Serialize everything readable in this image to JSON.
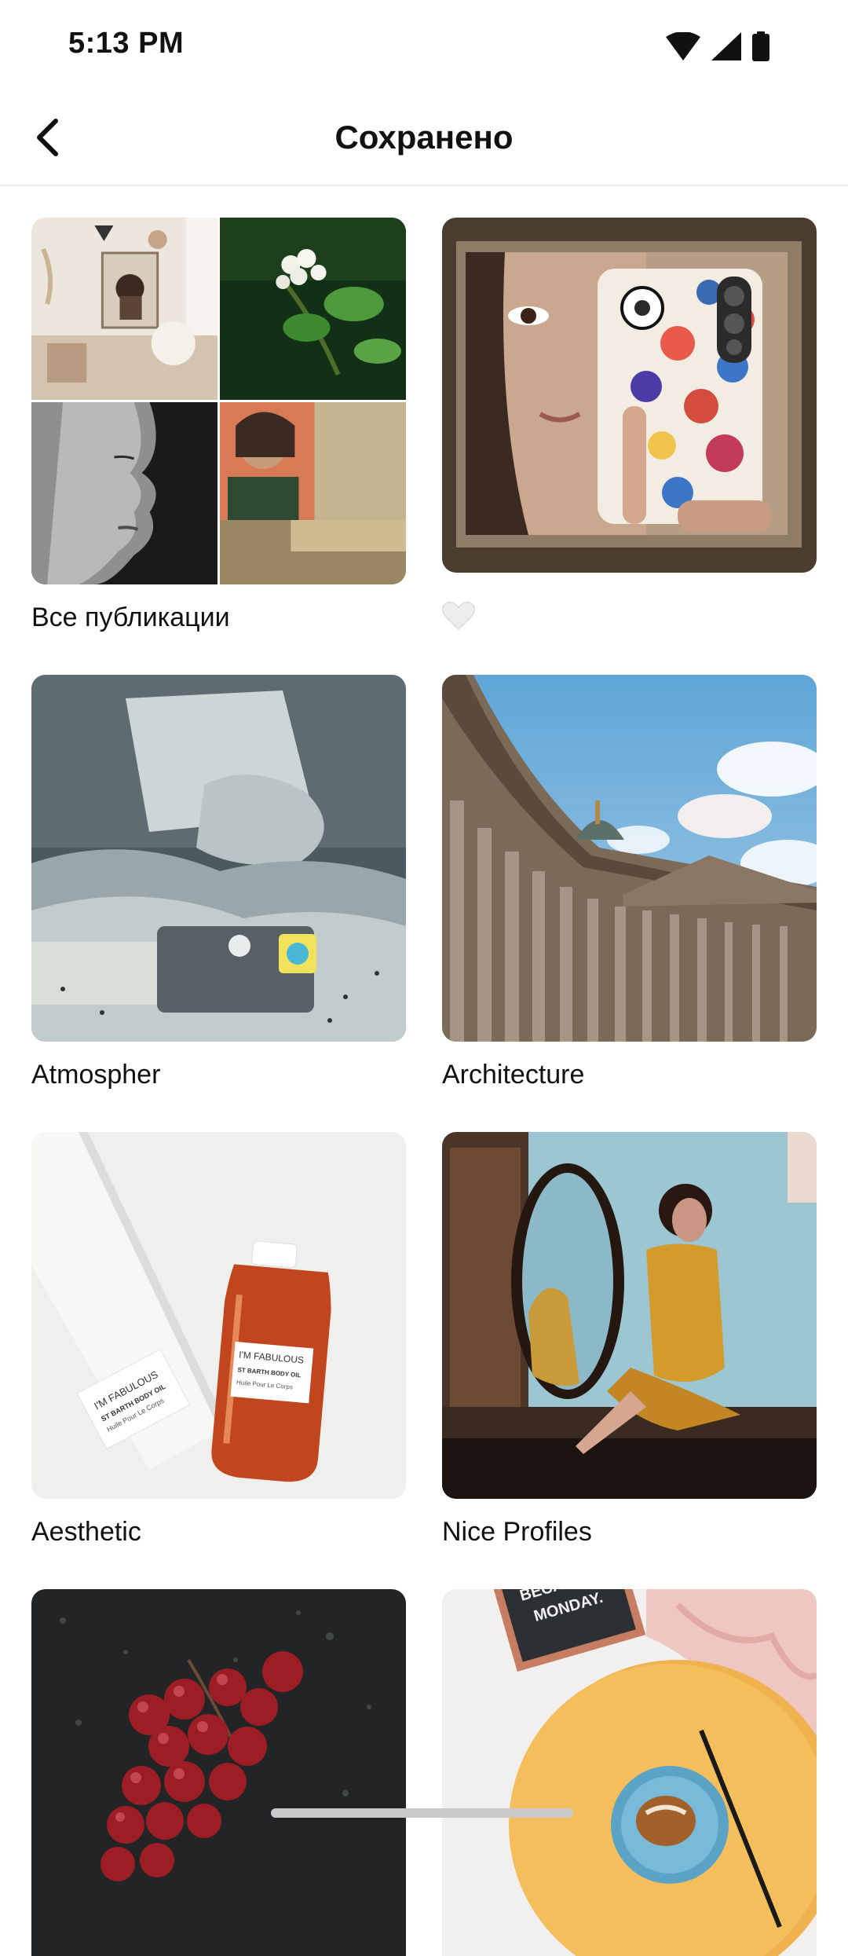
{
  "status_bar": {
    "time": "5:13 PM"
  },
  "header": {
    "title": "Сохранено"
  },
  "collections": [
    {
      "label": "Все публикации"
    },
    {
      "label": ""
    },
    {
      "label": "Atmospher"
    },
    {
      "label": "Architecture"
    },
    {
      "label": "Aesthetic"
    },
    {
      "label": "Nice Profiles"
    },
    {
      "label": ""
    },
    {
      "label": ""
    }
  ],
  "images": {
    "product_label": [
      "I'M FABULOUS",
      "ST BARTH BODY OIL",
      "Huile Pour Le Corps"
    ],
    "letterboard": [
      "BECAUSE",
      "MONDAY."
    ]
  },
  "colors": {
    "divider": "#ececec",
    "text": "#111111",
    "heart": "#e8e8e8"
  }
}
